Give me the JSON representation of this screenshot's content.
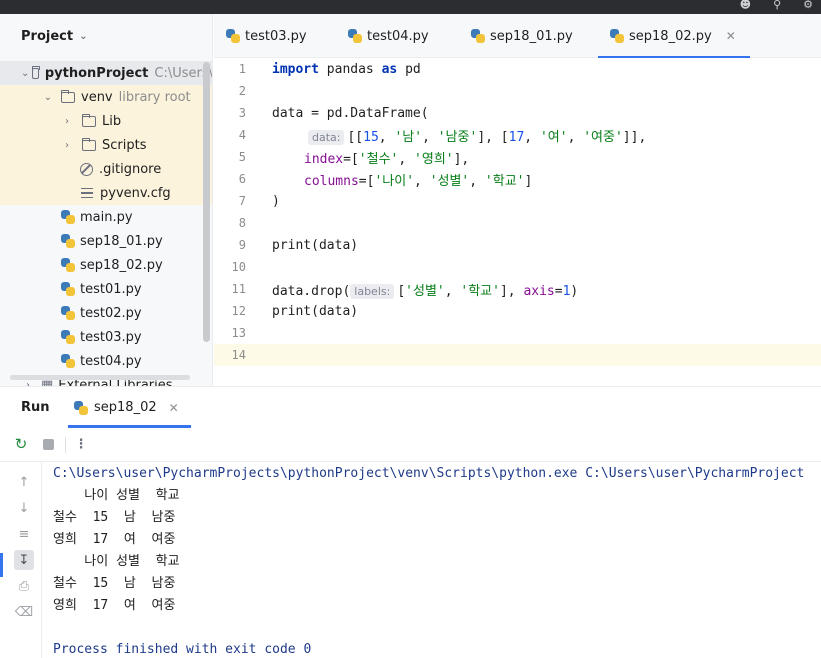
{
  "project_pane": {
    "title": "Project",
    "tree": [
      {
        "name": "pythonProject",
        "suffix": "C:\\Users\\"
      },
      {
        "name": "venv",
        "suffix": "library root"
      },
      {
        "name": "Lib"
      },
      {
        "name": "Scripts"
      },
      {
        "name": ".gitignore"
      },
      {
        "name": "pyvenv.cfg"
      },
      {
        "name": "main.py"
      },
      {
        "name": "sep18_01.py"
      },
      {
        "name": "sep18_02.py"
      },
      {
        "name": "test01.py"
      },
      {
        "name": "test02.py"
      },
      {
        "name": "test03.py"
      },
      {
        "name": "test04.py"
      },
      {
        "name": "External Libraries"
      }
    ]
  },
  "editor": {
    "tabs": [
      {
        "label": "test03.py"
      },
      {
        "label": "test04.py"
      },
      {
        "label": "sep18_01.py"
      },
      {
        "label": "sep18_02.py",
        "active": true
      }
    ],
    "line_numbers": [
      "1",
      "2",
      "3",
      "4",
      "5",
      "6",
      "7",
      "8",
      "9",
      "10",
      "11",
      "12",
      "13",
      "14"
    ],
    "code": {
      "l1_kw1": "import",
      "l1_mid": " pandas ",
      "l1_kw2": "as",
      "l1_end": " pd",
      "l3": "data = pd.DataFrame(",
      "l4_hint": "data:",
      "l4_a": "[[",
      "l4_n1": "15",
      "l4_b": ", ",
      "l4_s1": "'남'",
      "l4_c": ", ",
      "l4_s2": "'남중'",
      "l4_d": "], [",
      "l4_n2": "17",
      "l4_e": ", ",
      "l4_s3": "'여'",
      "l4_f": ", ",
      "l4_s4": "'여중'",
      "l4_g": "]],",
      "l5_param": "index",
      "l5_a": "=[",
      "l5_s1": "'철수'",
      "l5_b": ", ",
      "l5_s2": "'영희'",
      "l5_c": "],",
      "l6_param": "columns",
      "l6_a": "=[",
      "l6_s1": "'나이'",
      "l6_b": ", ",
      "l6_s2": "'성별'",
      "l6_c": ", ",
      "l6_s3": "'학교'",
      "l6_d": "]",
      "l7": ")",
      "l9": "print(data)",
      "l11_a": "data.drop(",
      "l11_hint": "labels:",
      "l11_b": "[",
      "l11_s1": "'성별'",
      "l11_c": ", ",
      "l11_s2": "'학교'",
      "l11_d": "], ",
      "l11_param": "axis",
      "l11_e": "=",
      "l11_n": "1",
      "l11_f": ")",
      "l12": "print(data)"
    }
  },
  "run_panel": {
    "title": "Run",
    "tab_label": "sep18_02",
    "console_lines": [
      "C:\\Users\\user\\PycharmProjects\\pythonProject\\venv\\Scripts\\python.exe C:\\Users\\user\\PycharmProject",
      "    나이 성별  학교",
      "철수  15  남  남중",
      "영희  17  여  여중",
      "    나이 성별  학교",
      "철수  15  남  남중",
      "영희  17  여  여중",
      "",
      "Process finished with exit code 0"
    ]
  }
}
